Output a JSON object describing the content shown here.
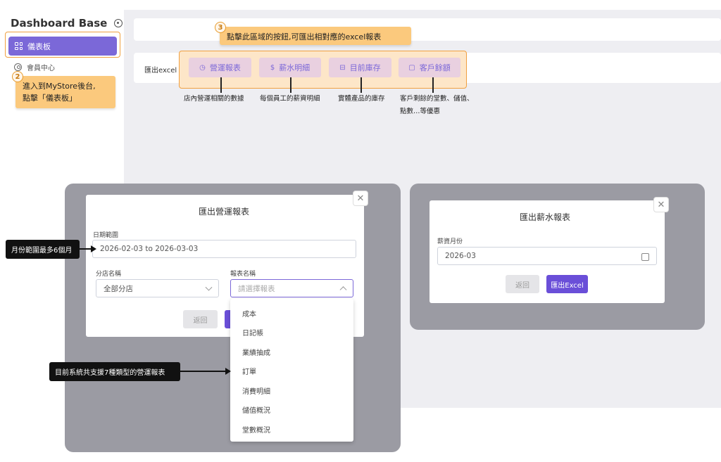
{
  "app": {
    "brand": "Dashboard Base"
  },
  "sidebar": {
    "items": [
      {
        "label": "儀表板"
      },
      {
        "label": "會員中心"
      }
    ]
  },
  "export_bar": {
    "label": "匯出excel",
    "buttons": [
      {
        "label": "營運報表",
        "icon": "clock-icon",
        "desc": "店內營運相關的數據"
      },
      {
        "label": "薪水明細",
        "icon": "dollar-icon",
        "desc": "每個員工的薪資明細"
      },
      {
        "label": "目前庫存",
        "icon": "box-icon",
        "desc": "實體產品的庫存"
      },
      {
        "label": "客戶餘額",
        "icon": "wallet-icon",
        "desc_lines": [
          "客戶剩餘的堂數、儲值、",
          "點數…等優惠"
        ]
      }
    ]
  },
  "callouts": {
    "step2": {
      "num": "2",
      "line1": "進入到MyStore後台,",
      "line2": "點擊「儀表板」"
    },
    "step3": {
      "num": "3",
      "text": "點擊此區域的按鈕,可匯出相對應的excel報表"
    },
    "month_range": "月份範圍最多6個月",
    "report_types": "目前系統共支援7種類型的營運報表"
  },
  "modal_ops": {
    "title": "匯出營運報表",
    "date_label": "日期範圍",
    "date_value": "2026-02-03 to 2026-03-03",
    "branch_label": "分店名稱",
    "branch_value": "全部分店",
    "report_label": "報表名稱",
    "report_placeholder": "請選擇報表",
    "back_label": "返回",
    "options": [
      "成本",
      "日記帳",
      "業績抽成",
      "訂單",
      "消費明細",
      "儲值概況",
      "堂數概況"
    ]
  },
  "modal_salary": {
    "title": "匯出薪水報表",
    "month_label": "薪資月份",
    "month_value": "2026-03",
    "back_label": "返回",
    "export_label": "匯出Excel"
  },
  "colors": {
    "accent": "#7b68d8",
    "primary": "#6a4fd8",
    "callout": "#fbc97d",
    "highlight": "#f0a040"
  }
}
